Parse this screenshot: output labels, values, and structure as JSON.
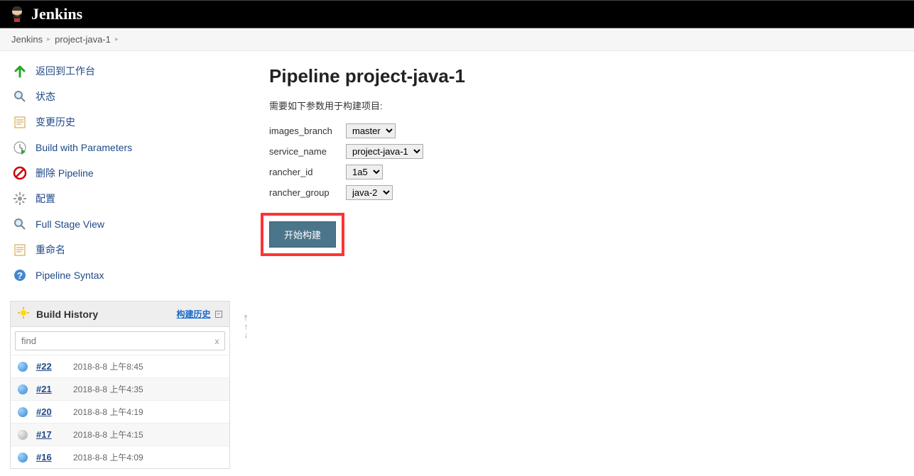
{
  "header": {
    "brand": "Jenkins"
  },
  "breadcrumbs": [
    {
      "label": "Jenkins"
    },
    {
      "label": "project-java-1"
    }
  ],
  "sidebar": {
    "items": [
      {
        "label": "返回到工作台"
      },
      {
        "label": "状态"
      },
      {
        "label": "变更历史"
      },
      {
        "label": "Build with Parameters"
      },
      {
        "label": "删除 Pipeline"
      },
      {
        "label": "配置"
      },
      {
        "label": "Full Stage View"
      },
      {
        "label": "重命名"
      },
      {
        "label": "Pipeline Syntax"
      }
    ]
  },
  "history": {
    "title": "Build History",
    "trend_link": "构建历史",
    "find_placeholder": "find",
    "builds": [
      {
        "num": "#22",
        "time": "2018-8-8 上午8:45",
        "ball": "blue"
      },
      {
        "num": "#21",
        "time": "2018-8-8 上午4:35",
        "ball": "blue"
      },
      {
        "num": "#20",
        "time": "2018-8-8 上午4:19",
        "ball": "blue"
      },
      {
        "num": "#17",
        "time": "2018-8-8 上午4:15",
        "ball": "grey"
      },
      {
        "num": "#16",
        "time": "2018-8-8 上午4:09",
        "ball": "blue"
      }
    ]
  },
  "main": {
    "title": "Pipeline project-java-1",
    "intro": "需要如下参数用于构建项目:",
    "params": [
      {
        "name": "images_branch",
        "value": "master"
      },
      {
        "name": "service_name",
        "value": "project-java-1"
      },
      {
        "name": "rancher_id",
        "value": "1a5"
      },
      {
        "name": "rancher_group",
        "value": "java-2"
      }
    ],
    "build_button": "开始构建"
  }
}
